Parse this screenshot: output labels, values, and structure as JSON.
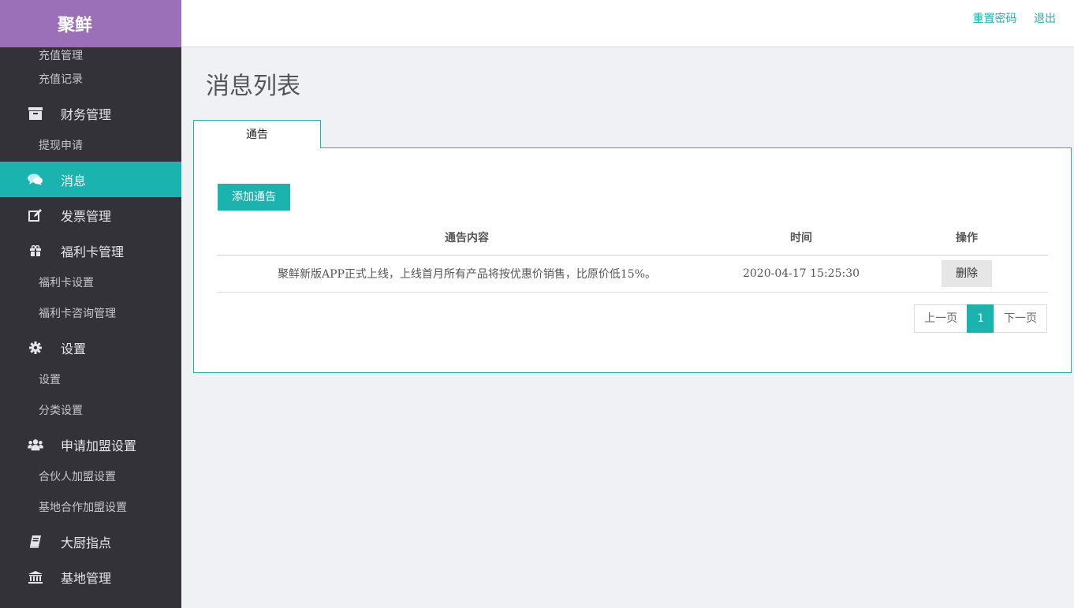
{
  "brand": "聚鲜",
  "nav": [
    {
      "kind": "sub",
      "label": "充值管理",
      "first": true
    },
    {
      "kind": "sub",
      "label": "充值记录"
    },
    {
      "kind": "main",
      "label": "财务管理",
      "icon": "archive-icon"
    },
    {
      "kind": "sub",
      "label": "提现申请"
    },
    {
      "kind": "main",
      "label": "消息",
      "icon": "comments-icon",
      "active": true
    },
    {
      "kind": "main",
      "label": "发票管理",
      "icon": "edit-icon"
    },
    {
      "kind": "main",
      "label": "福利卡管理",
      "icon": "gift-icon"
    },
    {
      "kind": "sub",
      "label": "福利卡设置"
    },
    {
      "kind": "sub",
      "label": "福利卡咨询管理"
    },
    {
      "kind": "main",
      "label": "设置",
      "icon": "gear-icon"
    },
    {
      "kind": "sub",
      "label": "设置"
    },
    {
      "kind": "sub",
      "label": "分类设置"
    },
    {
      "kind": "main",
      "label": "申请加盟设置",
      "icon": "users-icon"
    },
    {
      "kind": "sub",
      "label": "合伙人加盟设置"
    },
    {
      "kind": "sub",
      "label": "基地合作加盟设置"
    },
    {
      "kind": "main",
      "label": "大厨指点",
      "icon": "book-icon"
    },
    {
      "kind": "main",
      "label": "基地管理",
      "icon": "bank-icon"
    }
  ],
  "header": {
    "reset_password": "重置密码",
    "logout": "退出"
  },
  "page_title": "消息列表",
  "tab_label": "通告",
  "add_button": "添加通告",
  "table": {
    "columns": [
      "通告内容",
      "时间",
      "操作"
    ],
    "rows": [
      {
        "content": "聚鲜新版APP正式上线，上线首月所有产品将按优惠价销售，比原价低15%。",
        "time": "2020-04-17 15:25:30",
        "action": "删除"
      }
    ]
  },
  "pager": {
    "prev": "上一页",
    "current": "1",
    "next": "下一页"
  },
  "colors": {
    "accent": "#1bb3ad",
    "brand": "#9b70b8",
    "sidebar": "#323238"
  }
}
